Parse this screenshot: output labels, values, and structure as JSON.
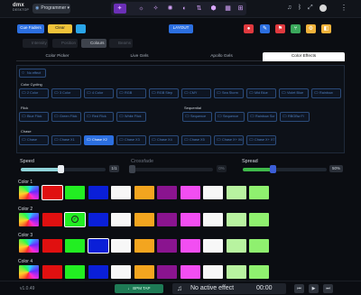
{
  "topbar": {
    "logo_main": "dmx",
    "logo_sub": "DESKTOP",
    "mode_label": "Programmer",
    "center_icons": [
      "stage-icon",
      "bulb-icon",
      "fixture-icon",
      "spot-icon",
      "dimmer-icon",
      "fader-icon",
      "palette-icon",
      "keypad-icon",
      "grid-icon"
    ],
    "right_icons": [
      "music-icon",
      "bluetooth-icon",
      "expand-icon"
    ],
    "menu": "⋮"
  },
  "toolbar": {
    "cue_faders": "Cue Faders",
    "clear": "Clear",
    "layout": "LAYOUT",
    "right_buttons": [
      {
        "name": "record-icon",
        "color": "#e0393e",
        "glyph": "●"
      },
      {
        "name": "edit-icon",
        "color": "#2c6fe0",
        "glyph": "✎"
      },
      {
        "name": "group-icon",
        "color": "#e0393e",
        "glyph": "⚑"
      },
      {
        "name": "tree-icon",
        "color": "#3aa75b",
        "glyph": "⑂"
      },
      {
        "name": "gear-icon",
        "color": "#f0b23a",
        "glyph": "⚙"
      },
      {
        "name": "cube-icon",
        "color": "#f0b23a",
        "glyph": "◧"
      }
    ]
  },
  "attr_tabs": [
    {
      "label": "Intensity",
      "active": false
    },
    {
      "label": "Position",
      "active": false
    },
    {
      "label": "Colours",
      "active": true
    },
    {
      "label": "Beams",
      "active": false
    }
  ],
  "main_tabs": [
    {
      "label": "Color Picker",
      "active": false
    },
    {
      "label": "Live Gels",
      "active": false
    },
    {
      "label": "Apollo Gels",
      "active": false
    },
    {
      "label": "Color Effects",
      "active": true
    }
  ],
  "effects": {
    "no_effect": "No effect",
    "color_cycling_title": "Color Cycling",
    "color_cycling": [
      "2 Color",
      "3 Color",
      "4 Color",
      "RGB",
      "RGB Step",
      "CMY",
      "Sea Storm",
      "Mid Blue",
      "Violet Blue",
      "Rainbow Follow"
    ],
    "flick_title": "Flick",
    "flick": [
      "Blue Flick",
      "Green Flick",
      "Red Flick",
      "White Flick"
    ],
    "sequential_title": "Sequential",
    "sequential": [
      "Sequence",
      "Sequence Ba..",
      "Rainbow Scr",
      "RBGBw Fi"
    ],
    "chase_title": "Chase",
    "chase": [
      "Chase",
      "Chase X1",
      "Chase X2",
      "Chase X3",
      "Chase X4",
      "Chase X5",
      "Chase X+ X6",
      "Chase X+ X7"
    ],
    "active_chase_index": 2
  },
  "sliders": {
    "speed_label": "Speed",
    "speed_value": "1/1",
    "speed_fraction": 0.47,
    "crossfade_label": "Crossfade",
    "crossfade_value": "0%",
    "crossfade_fraction": 0.0,
    "spread_label": "Spread",
    "spread_value": "50%",
    "spread_fraction": 0.36
  },
  "color_rows": [
    {
      "label": "Color 1",
      "colors": [
        "rainbow",
        "#e01010",
        "#22ee22",
        "#0a1fd8",
        "#f7f7f7",
        "#f3a51f",
        "#8a148f",
        "#f24ef2",
        "#f7f7f7",
        "#b8f3a0",
        "#8ff06f"
      ],
      "selected": 1
    },
    {
      "label": "Color 2",
      "colors": [
        "rainbow",
        "#e01010",
        "#22ee22",
        "#0a1fd8",
        "#f7f7f7",
        "#f3a51f",
        "#8a148f",
        "#f24ef2",
        "#f7f7f7",
        "#b8f3a0",
        "#8ff06f"
      ],
      "selected": 2
    },
    {
      "label": "Color 3",
      "colors": [
        "rainbow",
        "#e01010",
        "#22ee22",
        "#0a1fd8",
        "#f7f7f7",
        "#f3a51f",
        "#8a148f",
        "#f24ef2",
        "#f7f7f7",
        "#b8f3a0",
        "#8ff06f"
      ],
      "selected": 3
    },
    {
      "label": "Color 4",
      "colors": [
        "rainbow",
        "#e01010",
        "#22ee22",
        "#0a1fd8",
        "#f7f7f7",
        "#f3a51f",
        "#8a148f",
        "#f24ef2",
        "#f7f7f7",
        "#b8f3a0",
        "#8ff06f"
      ],
      "selected": -1
    }
  ],
  "bottom": {
    "version": "v1.0.49",
    "bpm_tap": "BPM TAP",
    "now_playing": "No active effect",
    "time": "00:00",
    "prev": "⏮",
    "play": "▶",
    "next": "⏭"
  }
}
